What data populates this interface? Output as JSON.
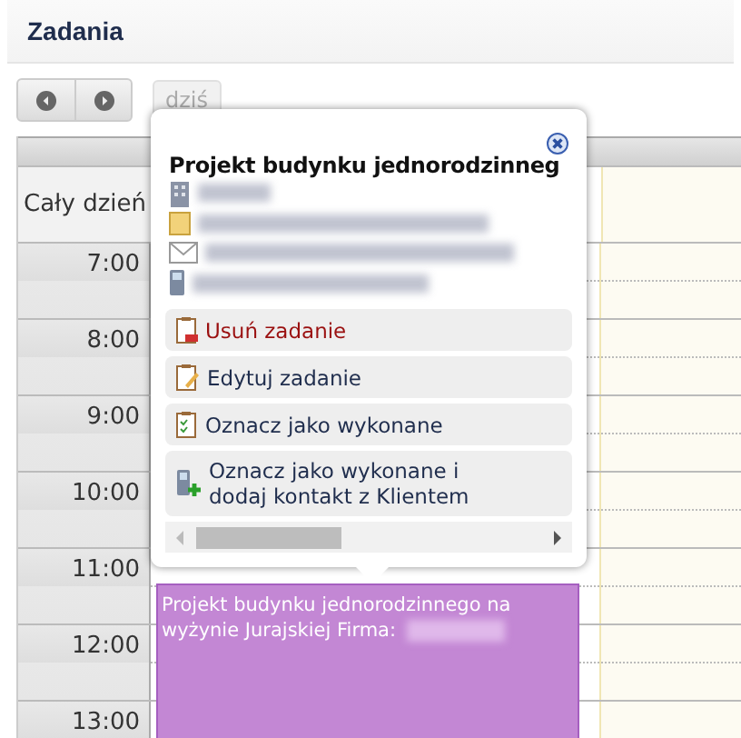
{
  "window": {
    "title": "Zadania"
  },
  "toolbar": {
    "today_button": {
      "label": "dziś",
      "disabled": true
    }
  },
  "calendar": {
    "all_day_label": "Cały dzień",
    "hours": [
      "7:00",
      "8:00",
      "9:00",
      "10:00",
      "11:00",
      "12:00",
      "13:00"
    ],
    "event": {
      "text": "Projekt budynku jednorodzinnego na wyżynie Jurajskiej Firma:",
      "color": "#c387d4"
    }
  },
  "popup": {
    "title": "Projekt budynku jednorodzinneg",
    "details": [
      {
        "kind": "company"
      },
      {
        "kind": "project"
      },
      {
        "kind": "email"
      },
      {
        "kind": "phone"
      }
    ],
    "actions": [
      {
        "label": "Usuń zadanie",
        "kind": "delete"
      },
      {
        "label": "Edytuj zadanie",
        "kind": "edit"
      },
      {
        "label": "Oznacz jako wykonane",
        "kind": "done"
      },
      {
        "label": "Oznacz jako wykonane i dodaj kontakt z Klientem",
        "kind": "done-contact"
      }
    ]
  }
}
